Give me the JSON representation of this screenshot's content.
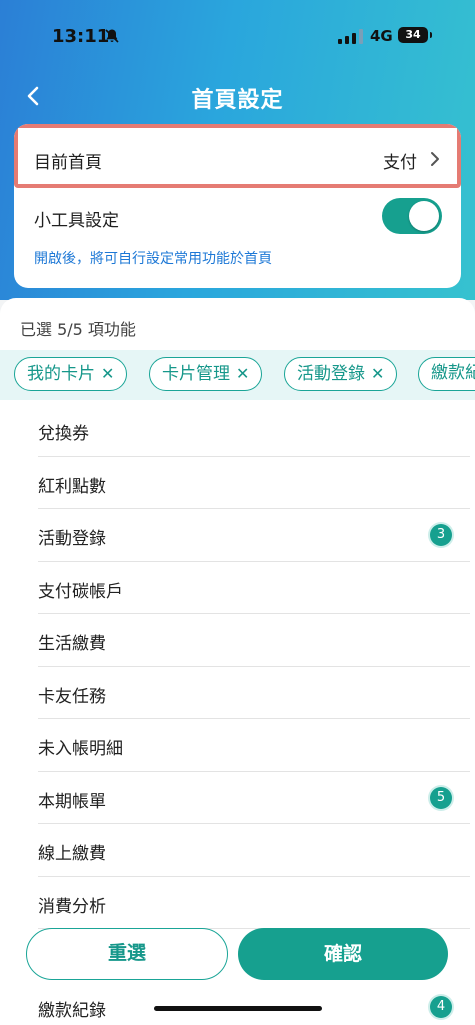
{
  "status_bar": {
    "time": "13:11",
    "network": "4G",
    "battery": "34"
  },
  "nav": {
    "title": "首頁設定"
  },
  "settings": {
    "current_home_label": "目前首頁",
    "current_home_value": "支付",
    "widget_label": "小工具設定",
    "widget_enabled": true,
    "hint": "開啟後，將可自行設定常用功能於首頁"
  },
  "selection": {
    "count_text": "已選 5/5 項功能",
    "chips": [
      {
        "label": "我的卡片",
        "remove": "✕"
      },
      {
        "label": "卡片管理",
        "remove": "✕"
      },
      {
        "label": "活動登錄",
        "remove": "✕"
      },
      {
        "label": "繳款紀"
      }
    ]
  },
  "list": {
    "items": [
      {
        "label": "兌換券",
        "badge": ""
      },
      {
        "label": "紅利點數",
        "badge": ""
      },
      {
        "label": "活動登錄",
        "badge": "3"
      },
      {
        "label": "支付碳帳戶",
        "badge": ""
      },
      {
        "label": "生活繳費",
        "badge": ""
      },
      {
        "label": "卡友任務",
        "badge": ""
      },
      {
        "label": "未入帳明細",
        "badge": ""
      },
      {
        "label": "本期帳單",
        "badge": "5"
      },
      {
        "label": "線上繳費",
        "badge": ""
      },
      {
        "label": "消費分析",
        "badge": ""
      }
    ],
    "last_item": {
      "label": "繳款紀錄",
      "badge": "4"
    }
  },
  "actions": {
    "reset_label": "重選",
    "confirm_label": "確認"
  },
  "colors": {
    "accent": "#16a08f",
    "highlight_border": "#e57b73",
    "link": "#1d78d6"
  }
}
